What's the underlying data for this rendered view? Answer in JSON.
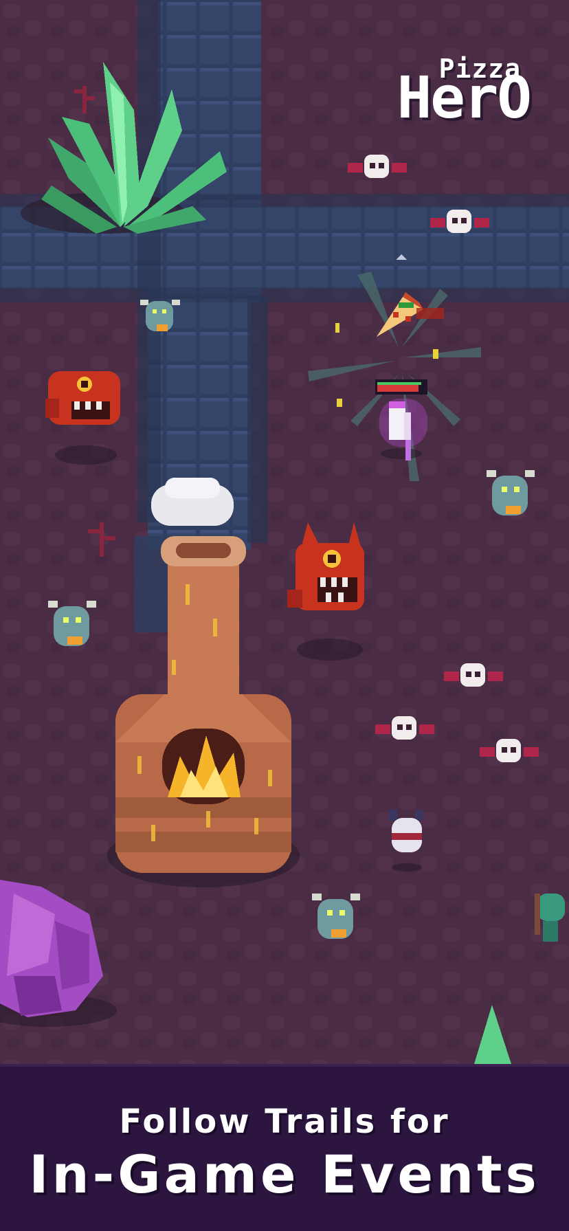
{
  "logo": {
    "line1": "Pizza",
    "line2": "HerO"
  },
  "banner": {
    "line1": "Follow Trails for",
    "line2": "In-Game Events"
  },
  "colors": {
    "ground": "#4a2c44",
    "path": "#2f3d5e",
    "banner": "#2c1640",
    "crystal_green": "#5fd08a",
    "crystal_purple": "#a44cc4",
    "oven_brick": "#c87a55",
    "fire": "#f6b42a",
    "health_bar": "#d83a3a"
  },
  "hud": {
    "player_health": 0.85
  },
  "icons": [
    "skull-bat-icon",
    "blue-bug-icon",
    "red-demon-icon",
    "pizza-slice-icon",
    "hero-icon",
    "brick-oven-icon"
  ]
}
